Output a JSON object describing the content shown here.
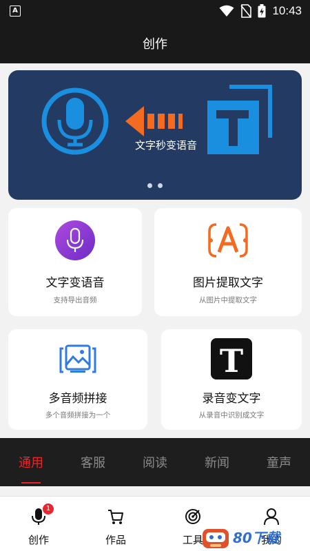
{
  "status_bar": {
    "time": "10:43",
    "app_icon": "A"
  },
  "header": {
    "title": "创作"
  },
  "banner": {
    "caption": "文字秒变语音",
    "page_count": 2
  },
  "cards": [
    {
      "title": "文字变语音",
      "subtitle": "支持导出音频",
      "icon": "microphone-icon"
    },
    {
      "title": "图片提取文字",
      "subtitle": "从图片中提取文字",
      "icon": "text-scan-icon"
    },
    {
      "title": "多音频拼接",
      "subtitle": "多个音频拼接为一个",
      "icon": "image-frame-icon"
    },
    {
      "title": "录音变文字",
      "subtitle": "从录音中识别成文字",
      "icon": "letter-t-icon"
    }
  ],
  "tabs": [
    "通用",
    "客服",
    "阅读",
    "新闻",
    "童声"
  ],
  "active_tab": "通用",
  "bottom_nav": [
    {
      "label": "创作",
      "badge": "1",
      "icon": "microphone-icon"
    },
    {
      "label": "作品",
      "icon": "cart-icon"
    },
    {
      "label": "工具",
      "icon": "target-icon"
    },
    {
      "label": "我的",
      "icon": "person-icon"
    }
  ],
  "watermark": {
    "text": "80下载"
  },
  "colors": {
    "accent": "#e8262c",
    "banner_bg": "#233b63",
    "bar_bg": "#191919"
  }
}
